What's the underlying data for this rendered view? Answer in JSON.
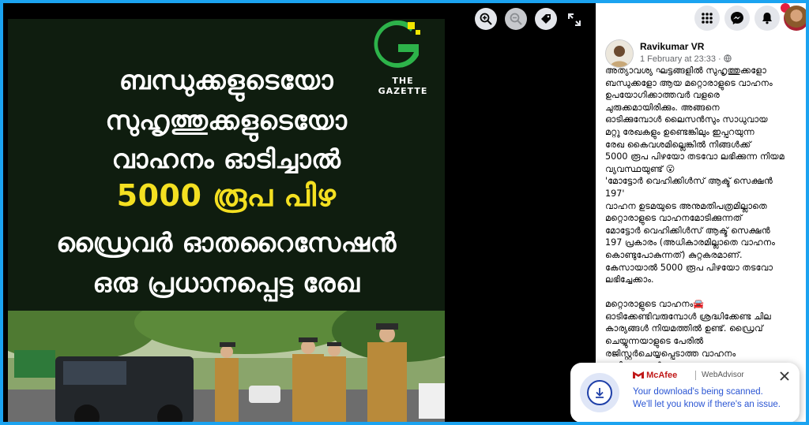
{
  "viewer": {
    "zoom_in": "zoom-in",
    "zoom_out": "zoom-out",
    "tag": "tag",
    "expand": "expand"
  },
  "image": {
    "headline_lines": [
      "ബന്ധുക്കളുടെയോ",
      "സുഹൃത്തുക്കളുടെയോ",
      "വാഹനം ഓടിച്ചാൽ",
      "5000 രൂപ പിഴ",
      "ഡ്രൈവർ ഓതറൈസേഷൻ",
      "ഒരു പ്രധാനപ്പെട്ട രേഖ"
    ],
    "logo_text": "THE\nGAZETTE",
    "highlight_color": "#f4e021",
    "logo_green": "#2db34a",
    "logo_yellow": "#f2e600"
  },
  "topbar": {
    "icons": [
      "menu-grid",
      "messenger",
      "notifications",
      "account"
    ],
    "notification_count": ""
  },
  "post": {
    "author": "Ravikumar VR",
    "time": "1 February at 23:33 · ",
    "paragraphs": [
      "അത്യാവശ്യ ഘട്ടങ്ങളിൽ സുഹൃത്തുക്കളോ\nബന്ധുക്കളോ ആയ മറ്റൊരാളുടെ വാഹനം\nഉപയോഗിക്കാത്തവർ വളരെ\nചുരുക്കമായിരിക്കും. അങ്ങനെ\nഓടിക്കുമ്പോൾ ലൈസൻസും സാധുവായ\nമറ്റു രേഖകളും ഉണ്ടെങ്കിലും ഇപ്പറയുന്ന\nരേഖ കൈവശമില്ലെങ്കിൽ നിങ്ങൾക്ക്\n5000 രൂപ പിഴയോ തടവോ ലഭിക്കുന്ന നിയമ\nവ്യവസ്ഥയുണ്ട് 😮\n'മോട്ടോർ വെഹിക്കിൾസ് ആക്ട് സെക്ഷൻ\n197'\nവാഹന ഉടമയുടെ അനുമതിപത്രമില്ലാതെ\nമറ്റൊരാളുടെ വാഹനമോടിക്കുന്നത്\nമോട്ടോർ വെഹിക്കിൾസ് ആക്ട് സെക്ഷൻ\n197 പ്രകാരം (അധികാരമില്ലാതെ വാഹനം\nകൊണ്ടുപോകുന്നത്) കുറ്റകരമാണ്.\nകേസായാൽ 5000 രൂപ പിഴയോ തടവോ\nലഭിച്ചേക്കാം.",
      "മറ്റൊരാളുടെ വാഹനം🚘\nഓടിക്കേണ്ടിവരുമ്പോൾ ശ്രദ്ധിക്കേണ്ട ചില\nകാര്യങ്ങൾ നിയമത്തിൽ ഉണ്ട്. ഡ്രൈവ്\nചെയ്യുന്നയാളുടെ പേരിൽ\nരജിസ്റ്റർചെയ്യപ്പെടാത്ത വാഹനം\nഓടിക്കുമ്പോൾ വാഹന ഉടമയുടെ"
    ]
  },
  "toast": {
    "brand": "McAfee",
    "product": "WebAdvisor",
    "line1": "Your download's being scanned.",
    "line2": "We'll let you know if there's an issue."
  },
  "colors": {
    "frame": "#1ba3f0",
    "mcafee_red": "#c01818",
    "toast_text": "#2a55d3"
  }
}
